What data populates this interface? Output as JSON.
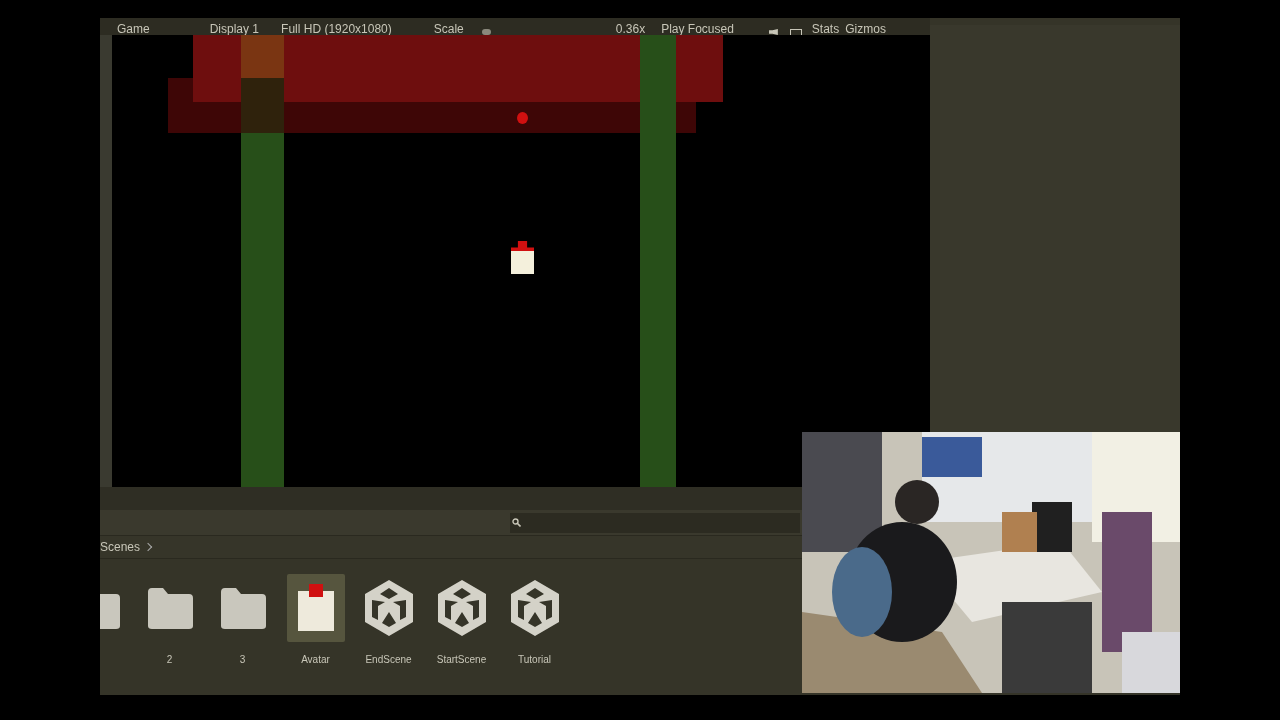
{
  "game_toolbar": {
    "tab": "Game",
    "display": "Display 1",
    "resolution": "Full HD (1920x1080)",
    "scale_label": "Scale",
    "scale_value": "0.36x",
    "play_mode": "Play Focused",
    "stats": "Stats",
    "gizmos": "Gizmos"
  },
  "project": {
    "breadcrumb": [
      "Scenes"
    ],
    "assets": [
      {
        "kind": "folder",
        "selected": false
      },
      {
        "kind": "folder",
        "label": "2",
        "selected": false
      },
      {
        "kind": "folder",
        "label": "3",
        "selected": false
      },
      {
        "kind": "prefab",
        "label": "Avatar",
        "selected": true
      },
      {
        "kind": "scene",
        "label": "EndScene",
        "selected": false
      },
      {
        "kind": "scene",
        "label": "StartScene",
        "selected": false
      },
      {
        "kind": "scene",
        "label": "Tutorial",
        "selected": false
      }
    ]
  }
}
